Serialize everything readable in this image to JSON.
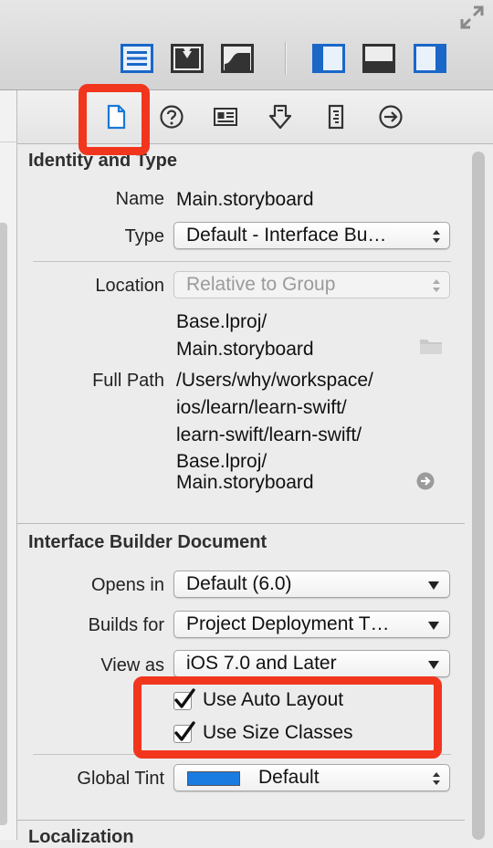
{
  "identity": {
    "title": "Identity and Type",
    "name_label": "Name",
    "name_value": "Main.storyboard",
    "type_label": "Type",
    "type_value": "Default - Interface Bu…",
    "location_label": "Location",
    "location_value": "Relative to Group",
    "location_path": [
      "Base.lproj/",
      "Main.storyboard"
    ],
    "fullpath_label": "Full Path",
    "fullpath_value": [
      "/Users/why/workspace/",
      "ios/learn/learn-swift/",
      "learn-swift/learn-swift/",
      "Base.lproj/",
      "Main.storyboard"
    ]
  },
  "ibdoc": {
    "title": "Interface Builder Document",
    "opens_in_label": "Opens in",
    "opens_in_value": "Default (6.0)",
    "builds_for_label": "Builds for",
    "builds_for_value": "Project Deployment T…",
    "view_as_label": "View as",
    "view_as_value": "iOS 7.0 and Later",
    "auto_layout_label": "Use Auto Layout",
    "auto_layout_checked": true,
    "size_classes_label": "Use Size Classes",
    "size_classes_checked": true,
    "global_tint_label": "Global Tint",
    "global_tint_value": "Default",
    "global_tint_color": "#1a7be0"
  },
  "localization": {
    "title": "Localization"
  },
  "colors": {
    "highlight": "#f2361e",
    "accent": "#1a78d6"
  },
  "icons": {
    "toolbar": [
      "standard-editor-icon",
      "assistant-editor-icon",
      "version-editor-icon",
      "navigator-toggle-icon",
      "debug-area-toggle-icon",
      "utilities-toggle-icon"
    ],
    "inspector": [
      "file-inspector-icon",
      "quick-help-icon",
      "identity-inspector-icon",
      "attributes-inspector-icon",
      "size-inspector-icon",
      "connections-inspector-icon"
    ]
  }
}
